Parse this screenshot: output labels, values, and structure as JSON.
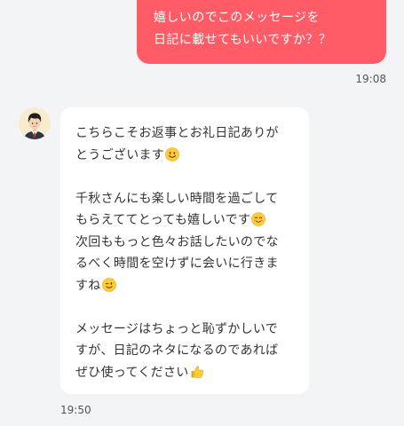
{
  "sent_message": {
    "lines": [
      "嬉しいのでこのメッセージを",
      "日記に載せてもいいですか？？"
    ],
    "time": "19:08",
    "bubble_color": "#ff5c67"
  },
  "received_message": {
    "lines": [
      "こちらこそお返事とお礼日記ありが",
      "とうございます",
      "",
      "千秋さんにも楽しい時間を過ごして",
      "もらえててとっても嬉しいです",
      "次回ももっと色々お話したいのでな",
      "るべく時間を空けずに会いに行きま",
      "すね",
      "",
      "メッセージはちょっと恥ずかしいで",
      "すが、日記のネタになるのであれば",
      "ぜひ使ってください"
    ],
    "emojis": {
      "line2": "smiling-face-emoji",
      "line5": "blushing-smile-emoji",
      "line8": "winking-face-emoji",
      "line12": "thumbs-up-emoji"
    },
    "time": "19:50",
    "avatar_icon": "user-avatar-icon"
  },
  "colors": {
    "background": "#f3f4f6",
    "sent_bubble": "#ff5c67",
    "received_bubble": "#ffffff"
  }
}
